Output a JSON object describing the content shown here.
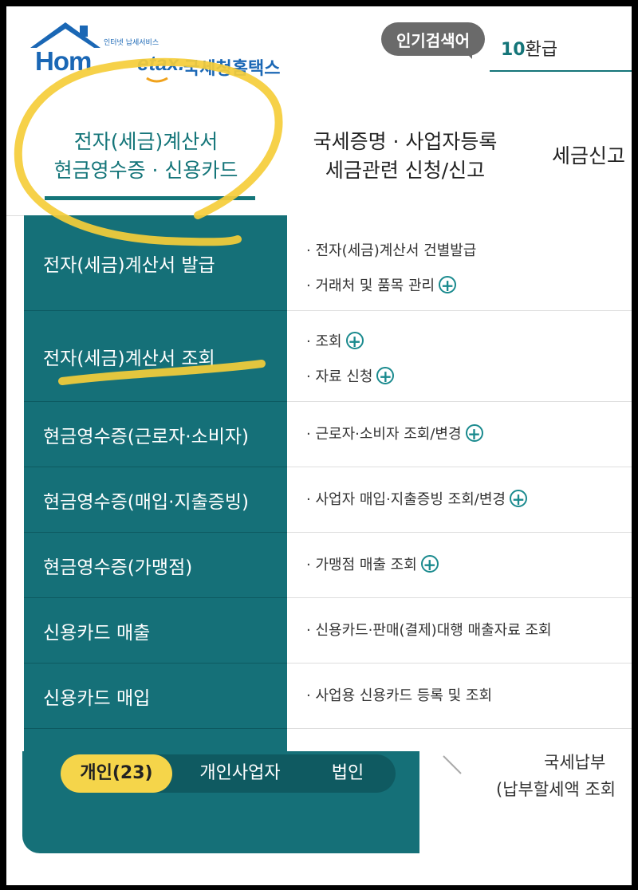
{
  "logo": {
    "home": "Hom",
    "tax": "etax.",
    "sub": "인터넷 납세서비스",
    "korean": "국세청홈택스"
  },
  "popular": {
    "badge": "인기검색어",
    "rank": "10",
    "keyword": "환급"
  },
  "tabs": [
    {
      "line1": "전자(세금)계산서",
      "line2": "현금영수증 · 신용카드"
    },
    {
      "line1": "국세증명 · 사업자등록",
      "line2": "세금관련 신청/신고"
    },
    {
      "line1": "세금신고"
    }
  ],
  "menu": {
    "rows": [
      {
        "category": "전자(세금)계산서 발급",
        "items": [
          "· 전자(세금)계산서 건별발급",
          "· 거래처 및 품목 관리"
        ]
      },
      {
        "category": "전자(세금)계산서 조회",
        "items": [
          "· 조회",
          "· 자료 신청"
        ]
      },
      {
        "category": "현금영수증(근로자·소비자)",
        "items": [
          "· 근로자·소비자 조회/변경"
        ]
      },
      {
        "category": "현금영수증(매입·지출증빙)",
        "items": [
          "· 사업자 매입·지출증빙 조회/변경"
        ]
      },
      {
        "category": "현금영수증(가맹점)",
        "items": [
          "· 가맹점 매출 조회"
        ]
      },
      {
        "category": "신용카드 매출",
        "items": [
          "· 신용카드·판매(결제)대행 매출자료 조회"
        ]
      },
      {
        "category": "신용카드 매입",
        "items": [
          "· 사업용 신용카드 등록 및 조회"
        ]
      }
    ]
  },
  "bottom": {
    "segments": [
      "개인(23)",
      "개인사업자",
      "법인"
    ],
    "right_line1": "국세납부",
    "right_line2": "(납부할세액 조회"
  },
  "colors": {
    "teal": "#157078",
    "accent": "#147579",
    "highlight": "#f5d54a"
  }
}
